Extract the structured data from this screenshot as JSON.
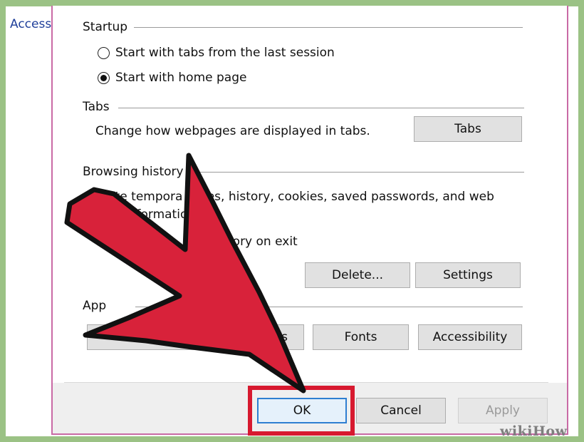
{
  "left_text": "Access",
  "startup": {
    "title": "Startup",
    "option_last_session": "Start with tabs from the last session",
    "option_home_page": "Start with home page"
  },
  "tabs": {
    "title": "Tabs",
    "description": "Change how webpages are displayed in tabs.",
    "button": "Tabs"
  },
  "browsing_history": {
    "title": "Browsing history",
    "line1": "elete tempora",
    "line1b": "les, history, cookies, saved passwords, and web",
    "line2": "informatio",
    "line3a": "bro",
    "line3b": "tory on exit",
    "delete_button": "Delete...",
    "settings_button": "Settings"
  },
  "appearance": {
    "title_visible": "App",
    "partial_button_text": "s",
    "fonts_button": "Fonts",
    "accessibility_button": "Accessibility"
  },
  "footer": {
    "ok_button": "OK",
    "cancel_button": "Cancel",
    "apply_button": "Apply"
  },
  "watermark": "wikiHow",
  "colors": {
    "green_frame": "#9bc285",
    "pink_border": "#c96aa5",
    "highlight_red": "#d7192f",
    "arrow_red": "#d8223a"
  }
}
